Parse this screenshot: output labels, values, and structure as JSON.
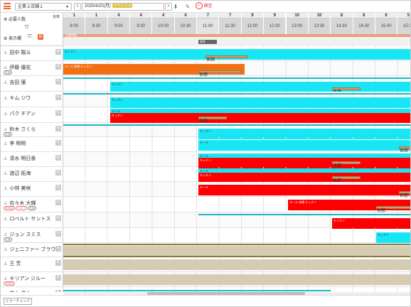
{
  "toolbar": {
    "store": "企業２店舗１",
    "date": "2020/4/20(月)",
    "event_label": "イベント",
    "confirm_label": "確定",
    "prev": "<",
    "next": ">"
  },
  "sidebar": {
    "required_people": "必要人数",
    "all": "全体",
    "display_toggle": "表示欄"
  },
  "time_columns": [
    {
      "count": "1",
      "time": "8:00"
    },
    {
      "count": "1",
      "time": "8:30"
    },
    {
      "count": "4",
      "time": "9:00"
    },
    {
      "count": "4",
      "time": "9:30"
    },
    {
      "count": "4",
      "time": "10:00"
    },
    {
      "count": "4",
      "time": "10:30"
    },
    {
      "count": "7",
      "time": "11:00"
    },
    {
      "count": "7",
      "time": "11:30"
    },
    {
      "count": "9",
      "time": "12:00"
    },
    {
      "count": "9",
      "time": "12:30"
    },
    {
      "count": "10",
      "time": "13:00"
    },
    {
      "count": "10",
      "time": "13:30"
    },
    {
      "count": "8",
      "time": "14:30"
    },
    {
      "count": "8",
      "time": "14:30"
    },
    {
      "count": "6",
      "time": "15:00"
    },
    {
      "count": "5",
      "time": "15:30"
    }
  ],
  "header": {
    "orange_strip_label": "営業時間",
    "gray_tag": "昼休"
  },
  "employees": [
    {
      "name": "田中 陽斗",
      "tags": []
    },
    {
      "name": "伊藤 優花",
      "tags": [
        {
          "text": "社員",
          "g": true
        }
      ]
    },
    {
      "name": "吉田 蓮",
      "tags": []
    },
    {
      "name": "キム ジウ",
      "tags": []
    },
    {
      "name": "パク チアン",
      "tags": []
    },
    {
      "name": "鈴木 さくら",
      "tags": [
        {
          "text": "社員",
          "g": true
        }
      ]
    },
    {
      "name": "李 明明",
      "tags": []
    },
    {
      "name": "清水 明日香",
      "tags": []
    },
    {
      "name": "渡辺 拓海",
      "tags": []
    },
    {
      "name": "小林 美咲",
      "tags": []
    },
    {
      "name": "佐々木 大輝",
      "tags": [
        {
          "text": "未承認",
          "g": false
        },
        {
          "text": "ヘルプ",
          "g": false
        },
        {
          "text": "社員",
          "g": true
        }
      ]
    },
    {
      "name": "ロベルト サントス",
      "tags": []
    },
    {
      "name": "ジョン スミス",
      "tags": [
        {
          "text": "社員",
          "g": true
        }
      ]
    },
    {
      "name": "ジェニファー ブラウン",
      "tags": []
    },
    {
      "name": "王 芳",
      "tags": []
    },
    {
      "name": "キリアン ジルー",
      "tags": [
        {
          "text": "未承認",
          "g": false
        }
      ]
    },
    {
      "name": "井上 優斗",
      "tags": []
    }
  ],
  "shift_labels": {
    "kitchen": "キッチン",
    "hall": "ホール",
    "break": "休憩",
    "hall_full": "ホール 休憩 キッチン"
  },
  "footer": {
    "error_check": "エラーチェック"
  }
}
